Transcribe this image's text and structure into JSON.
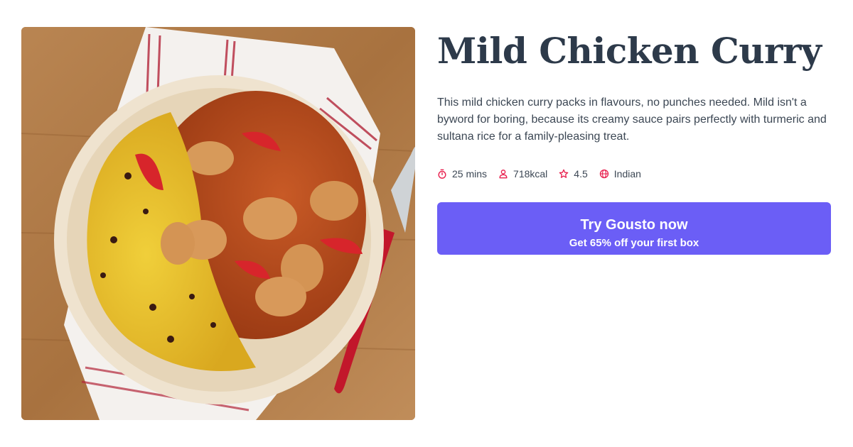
{
  "recipe": {
    "title": "Mild Chicken Curry",
    "description": "This mild chicken curry packs in flavours, no punches needed. Mild isn't a byword for boring, because its creamy sauce pairs perfectly with turmeric and sultana rice for a family-pleasing treat.",
    "image": "photo of mild chicken curry with yellow turmeric sultana rice in a cream bowl, red-handled spoon and striped tea towel on wooden table"
  },
  "meta": [
    {
      "icon": "timer-icon",
      "text": "25 mins"
    },
    {
      "icon": "person-icon",
      "text": "718kcal"
    },
    {
      "icon": "star-icon",
      "text": "4.5"
    },
    {
      "icon": "globe-icon",
      "text": "Indian"
    }
  ],
  "cta": {
    "label": "Try Gousto now",
    "sublabel": "Get 65% off your first box"
  },
  "colors": {
    "title": "#2d3a4a",
    "body_text": "#3c4754",
    "accent_icon": "#e8214f",
    "cta_background": "#6b5ef6",
    "cta_text": "#ffffff"
  }
}
